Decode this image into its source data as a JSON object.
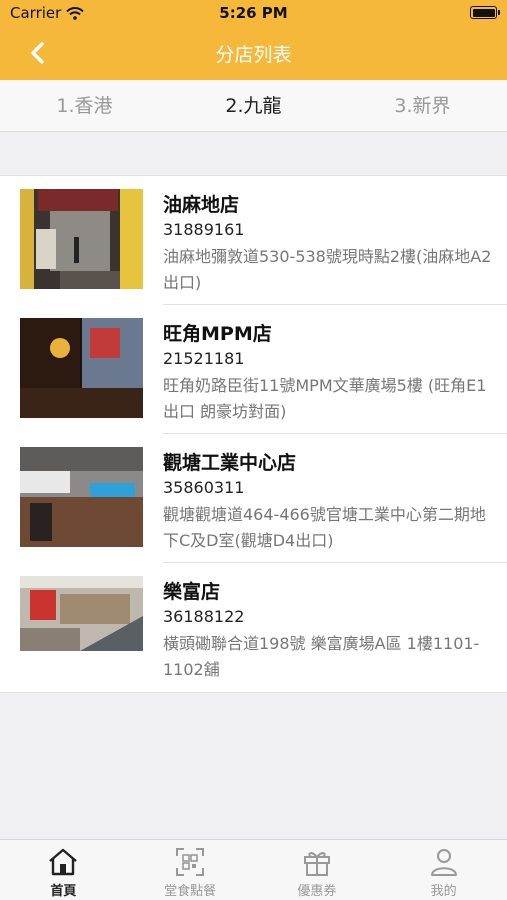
{
  "status_bar": {
    "carrier": "Carrier",
    "time": "5:26 PM"
  },
  "nav": {
    "title": "分店列表",
    "back_icon": "chevron-left-icon"
  },
  "region_tabs": [
    {
      "label": "1.香港",
      "active": false
    },
    {
      "label": "2.九龍",
      "active": true
    },
    {
      "label": "3.新界",
      "active": false
    }
  ],
  "branches": [
    {
      "name": "油麻地店",
      "phone": "31889161",
      "address": "油麻地彌敦道530-538號現時點2樓(油麻地A2出口)"
    },
    {
      "name": "旺角MPM店",
      "phone": "21521181",
      "address": "旺角奶路臣街11號MPM文華廣場5樓 (旺角E1出口 朗豪坊對面)"
    },
    {
      "name": "觀塘工業中心店",
      "phone": "35860311",
      "address": "觀塘觀塘道464-466號官塘工業中心第二期地下C及D室(觀塘D4出口)"
    },
    {
      "name": "樂富店",
      "phone": "36188122",
      "address": "橫頭磡聯合道198號 樂富廣場A區 1樓1101-1102舖"
    }
  ],
  "tab_bar": [
    {
      "label": "首頁",
      "icon": "home-icon",
      "active": true
    },
    {
      "label": "堂食點餐",
      "icon": "qr-scan-icon",
      "active": false
    },
    {
      "label": "優惠券",
      "icon": "gift-icon",
      "active": false
    },
    {
      "label": "我的",
      "icon": "person-icon",
      "active": false
    }
  ],
  "colors": {
    "accent": "#f5b83a",
    "background": "#efeff4",
    "active_text": "#222222",
    "inactive_text": "#999999"
  }
}
